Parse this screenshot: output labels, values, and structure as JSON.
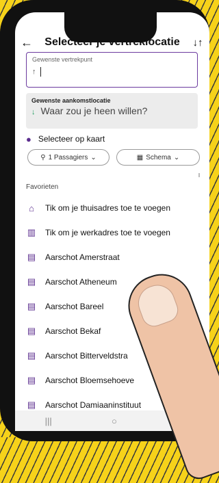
{
  "header": {
    "title": "Selecteer je vertreklocatie",
    "back_icon": "←",
    "swap_icon": "↓↑"
  },
  "departure": {
    "label": "Gewenste vertrekpunt",
    "arrow": "↑",
    "value": ""
  },
  "arrival": {
    "label": "Gewenste aankomstlocatie",
    "arrow": "↓",
    "placeholder": "Waar zou je heen willen?"
  },
  "map_select": {
    "label": "Selecteer op kaart"
  },
  "chips": {
    "passengers": "1 Passagiers",
    "schedule": "Schema"
  },
  "favorites": {
    "heading": "Favorieten",
    "items": [
      {
        "icon": "home-icon",
        "label": "Tik om je thuisadres toe te voegen"
      },
      {
        "icon": "work-icon",
        "label": "Tik om je werkadres toe te voegen"
      },
      {
        "icon": "bus-icon",
        "label": "Aarschot Amerstraat"
      },
      {
        "icon": "bus-icon",
        "label": "Aarschot Atheneum"
      },
      {
        "icon": "bus-icon",
        "label": "Aarschot Bareel"
      },
      {
        "icon": "bus-icon",
        "label": "Aarschot Bekaf"
      },
      {
        "icon": "bus-icon",
        "label": "Aarschot Bitterveldstra"
      },
      {
        "icon": "bus-icon",
        "label": "Aarschot Bloemsehoeve"
      },
      {
        "icon": "bus-icon",
        "label": "Aarschot Damiaaninstituut"
      }
    ]
  },
  "colors": {
    "accent": "#6b3a9e",
    "green": "#1a9c5b",
    "background": "#f6d21a"
  }
}
